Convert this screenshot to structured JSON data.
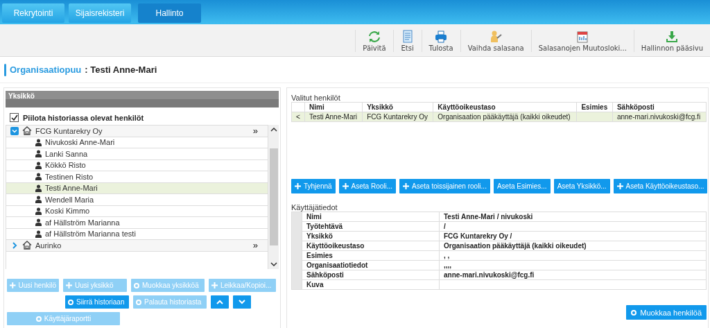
{
  "nav_tabs": [
    {
      "label": "Rekrytointi",
      "selected": false
    },
    {
      "label": "Sijaisrekisteri",
      "selected": false
    },
    {
      "label": "Hallinto",
      "selected": true
    }
  ],
  "toolbar": [
    {
      "kind": "refresh",
      "label": "Päivitä"
    },
    {
      "kind": "document",
      "label": "Etsi"
    },
    {
      "kind": "printer",
      "label": "Tulosta"
    },
    {
      "kind": "key",
      "label": "Vaihda salasana"
    },
    {
      "kind": "calendar",
      "label": "Salasanojen Muutosloki..."
    },
    {
      "kind": "download",
      "label": "Hallinnon pääsivu"
    }
  ],
  "page_title": {
    "section": "Organisaatiopuu",
    "current": ": Testi Anne-Mari"
  },
  "unit_panel": {
    "header": "Yksikkö",
    "hide_history": {
      "label": "Piilota historiassa olevat henkilöt",
      "checked": true
    },
    "tree": [
      {
        "kind": "unit",
        "label": "FCG Kuntarekry Oy",
        "more": "»",
        "expanded": true,
        "selected": false,
        "children": [
          {
            "kind": "person",
            "label": "Nivukoski Anne-Mari",
            "selected": false
          },
          {
            "kind": "person",
            "label": "Lanki Sanna",
            "selected": false
          },
          {
            "kind": "person",
            "label": "Kökkö Risto",
            "selected": false
          },
          {
            "kind": "person",
            "label": "Testinen Risto",
            "selected": false
          },
          {
            "kind": "person",
            "label": "Testi Anne-Mari",
            "selected": true
          },
          {
            "kind": "person",
            "label": "Wendell Maria",
            "selected": false
          },
          {
            "kind": "person",
            "label": "Koski Kimmo",
            "selected": false
          },
          {
            "kind": "person",
            "label": "af Hällström Marianna",
            "selected": false
          },
          {
            "kind": "person",
            "label": "af Hällström Marianna testi",
            "selected": false
          }
        ]
      },
      {
        "kind": "unit",
        "label": "Aurinko",
        "more": "»",
        "expanded": false,
        "selected": false
      }
    ],
    "buttons": [
      {
        "label": "Uusi henkilö",
        "kind": "plus",
        "disabled": true
      },
      {
        "label": "Uusi yksikkö",
        "kind": "plus",
        "disabled": true
      },
      {
        "label": "Muokkaa yksikköä",
        "kind": "dot",
        "disabled": true
      },
      {
        "label": "Leikkaa/Kopioi...",
        "kind": "plus",
        "disabled": true
      },
      {
        "label": "Siirrä historiaan",
        "kind": "dot",
        "disabled": false
      },
      {
        "label": "Palauta historiasta",
        "kind": "dot",
        "disabled": true
      },
      {
        "kind": "up",
        "disabled": false
      },
      {
        "kind": "down",
        "disabled": false
      },
      {
        "label": "Käyttäjäraportti",
        "kind": "dot",
        "disabled": true
      }
    ]
  },
  "selected_persons": {
    "title": "Valitut henkilöt",
    "columns": [
      "Nimi",
      "Yksikkö",
      "Käyttöoikeustaso",
      "Esimies",
      "Sähköposti"
    ],
    "rows": [
      {
        "marker": "<",
        "selected": true,
        "cells": [
          "Testi Anne-Mari",
          "FCG Kuntarekry Oy",
          "Organisaation pääkäyttäjä (kaikki oikeudet)",
          "",
          "anne-mari.nivukoski@fcg.fi"
        ]
      }
    ]
  },
  "action_buttons": [
    {
      "label": "Tyhjennä",
      "kind": "plus"
    },
    {
      "label": "Aseta Rooli...",
      "kind": "plus"
    },
    {
      "label": "Aseta toissijainen rooli...",
      "kind": "plus"
    },
    {
      "label": "Aseta Esimies...",
      "kind": "text"
    },
    {
      "label": "Aseta Yksikkö...",
      "kind": "text"
    },
    {
      "label": "Aseta Käyttöoikeustaso...",
      "kind": "plus"
    }
  ],
  "user_info": {
    "title": "Käyttäjätiedot",
    "rows": [
      {
        "label": "Nimi",
        "value": "Testi Anne-Mari / nivukoski"
      },
      {
        "label": "Työtehtävä",
        "value": " /"
      },
      {
        "label": "Yksikkö",
        "value": "FCG Kuntarekry Oy /"
      },
      {
        "label": "Käyttöoikeustaso",
        "value": "Organisaation pääkäyttäjä (kaikki oikeudet)"
      },
      {
        "label": "Esimies",
        "value": ", ,"
      },
      {
        "label": "Organisaatiotiedot",
        "value": ",,,,"
      },
      {
        "label": "Sähköposti",
        "value": "anne-mari.nivukoski@fcg.fi"
      },
      {
        "label": "Kuva"
      }
    ]
  },
  "edit_button": {
    "label": "Muokkaa henkilöä",
    "kind": "dot"
  }
}
